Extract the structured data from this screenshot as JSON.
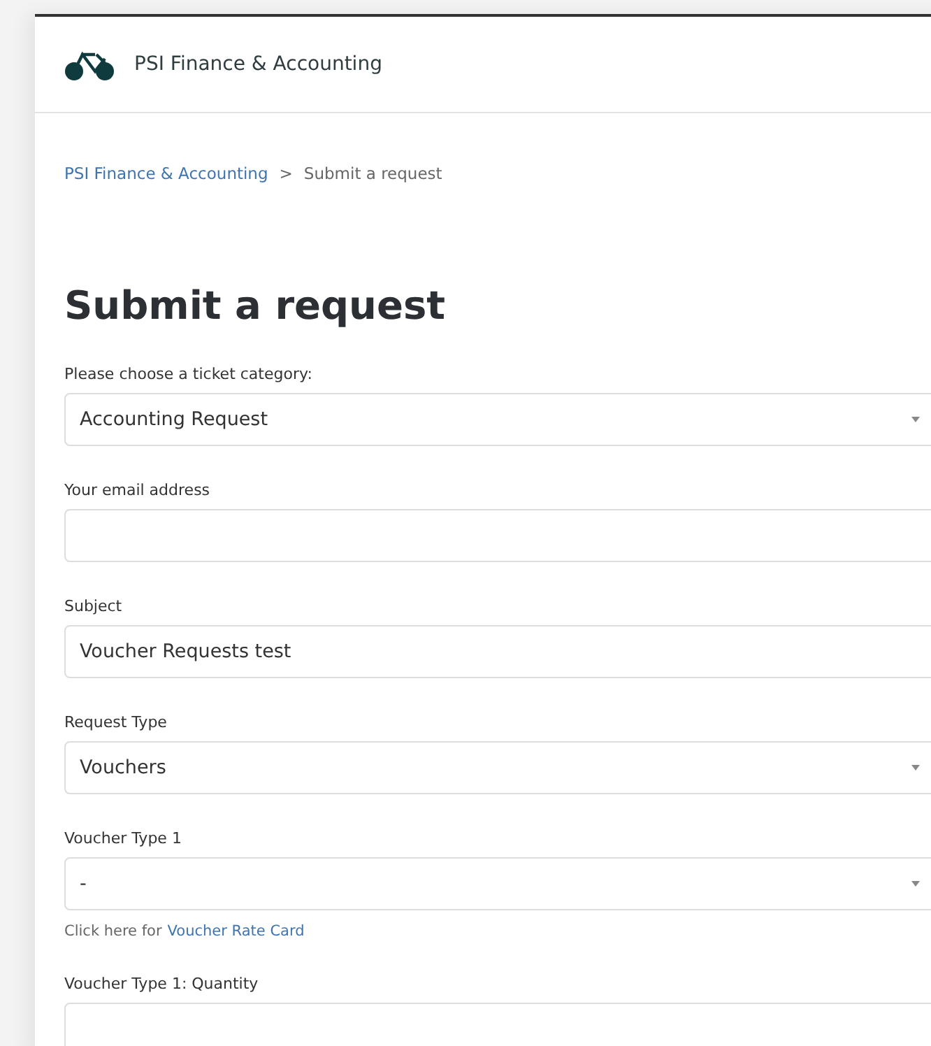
{
  "header": {
    "brand": "PSI Finance & Accounting"
  },
  "breadcrumb": [
    {
      "label": "PSI Finance & Accounting",
      "kind": "link"
    },
    {
      "label": ">",
      "kind": "separator"
    },
    {
      "label": "Submit a request",
      "kind": "current"
    }
  ],
  "title": "Submit a request",
  "fields": [
    {
      "label": "Please choose a ticket category:",
      "kind": "select",
      "value": "Accounting Request"
    },
    {
      "label": "Your email address",
      "kind": "text"
    },
    {
      "label": "Subject",
      "kind": "text",
      "value": "Voucher Requests test"
    },
    {
      "label": "Request Type",
      "kind": "select",
      "value": "Vouchers"
    },
    {
      "label": "Voucher Type 1",
      "kind": "select",
      "value": "-",
      "hint": {
        "text": "Click here for",
        "link": "Voucher Rate Card"
      }
    },
    {
      "label": "Voucher Type 1: Quantity",
      "kind": "text"
    }
  ]
}
